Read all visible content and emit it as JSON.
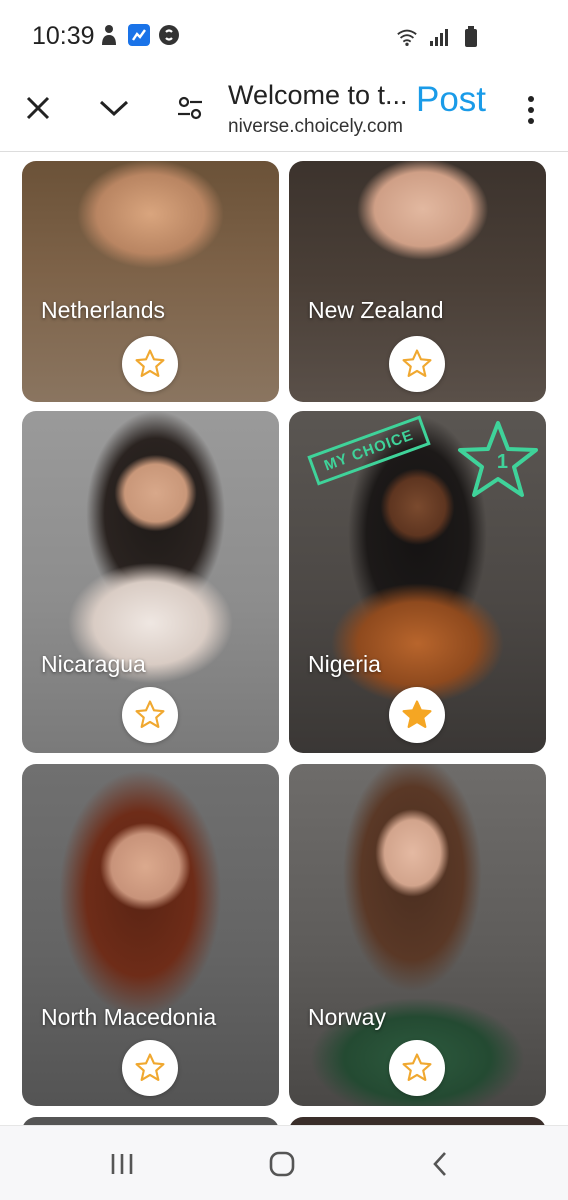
{
  "status": {
    "time": "10:39",
    "left_icons": [
      "person-icon",
      "fitness-app-icon",
      "shazam-icon"
    ],
    "right_icons": [
      "wifi-icon",
      "signal-icon",
      "battery-icon"
    ]
  },
  "toolbar": {
    "title": "Welcome to t...",
    "url": "niverse.choicely.com",
    "post_label": "Post",
    "accent": "#1a9be8"
  },
  "cards": [
    {
      "name": "Netherlands",
      "favorited": false
    },
    {
      "name": "New Zealand",
      "favorited": false
    },
    {
      "name": "Nicaragua",
      "favorited": false
    },
    {
      "name": "Nigeria",
      "favorited": true,
      "stamp": "MY CHOICE",
      "rank": "1"
    },
    {
      "name": "North Macedonia",
      "favorited": false
    },
    {
      "name": "Norway",
      "favorited": false
    }
  ],
  "colors": {
    "star_outline": "#f0a830",
    "star_fill": "#f5a623",
    "choice_green": "#3fd39a"
  },
  "navbar": {
    "icons": [
      "recent-apps-icon",
      "home-icon",
      "back-icon"
    ]
  }
}
